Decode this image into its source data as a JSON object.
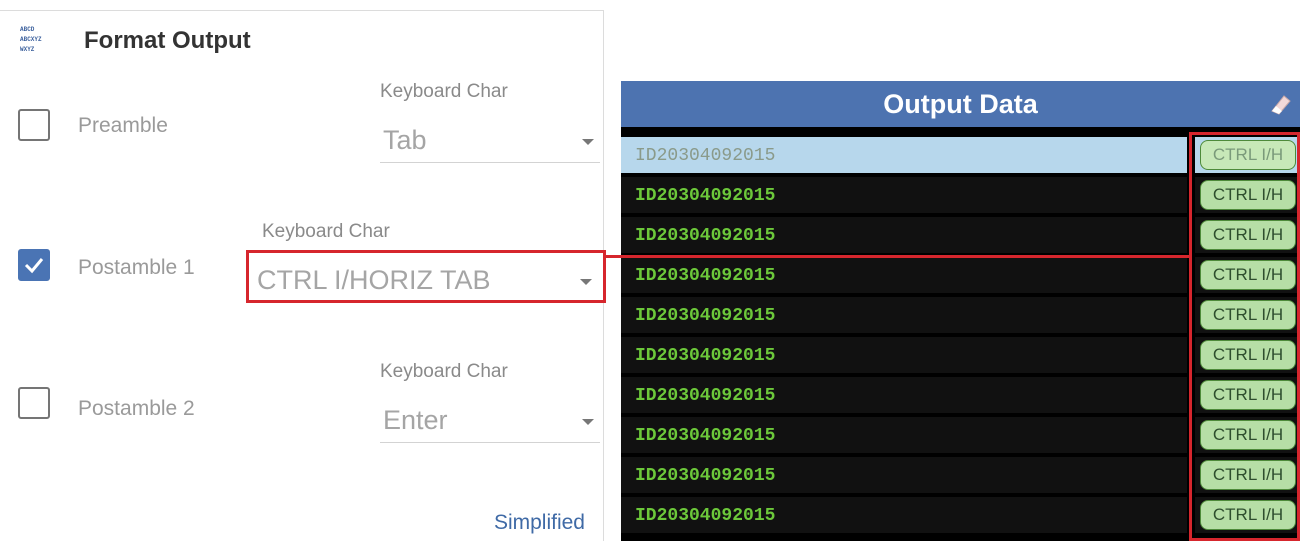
{
  "format_panel": {
    "title": "Format Output",
    "icon_lines": [
      "ABCD",
      "ABCXYZ",
      "WXYZ"
    ],
    "rows": [
      {
        "label": "Preamble",
        "checked": false,
        "keyboard_label": "Keyboard Char",
        "value": "Tab"
      },
      {
        "label": "Postamble 1",
        "checked": true,
        "keyboard_label": "Keyboard Char",
        "value": "CTRL I/HORIZ TAB"
      },
      {
        "label": "Postamble 2",
        "checked": false,
        "keyboard_label": "Keyboard Char",
        "value": "Enter"
      }
    ],
    "simplified_link": "Simplified"
  },
  "output_panel": {
    "title": "Output Data",
    "rows": [
      {
        "id": "ID20304092015",
        "tag": "CTRL I/H",
        "selected": true
      },
      {
        "id": "ID20304092015",
        "tag": "CTRL I/H",
        "selected": false
      },
      {
        "id": "ID20304092015",
        "tag": "CTRL I/H",
        "selected": false
      },
      {
        "id": "ID20304092015",
        "tag": "CTRL I/H",
        "selected": false
      },
      {
        "id": "ID20304092015",
        "tag": "CTRL I/H",
        "selected": false
      },
      {
        "id": "ID20304092015",
        "tag": "CTRL I/H",
        "selected": false
      },
      {
        "id": "ID20304092015",
        "tag": "CTRL I/H",
        "selected": false
      },
      {
        "id": "ID20304092015",
        "tag": "CTRL I/H",
        "selected": false
      },
      {
        "id": "ID20304092015",
        "tag": "CTRL I/H",
        "selected": false
      },
      {
        "id": "ID20304092015",
        "tag": "CTRL I/H",
        "selected": false
      }
    ]
  },
  "colors": {
    "accent": "#4a74b4",
    "header": "#4d73b0",
    "output_text": "#6cc83a",
    "callout": "#d6262d",
    "selected_row": "#b7d7ec"
  }
}
